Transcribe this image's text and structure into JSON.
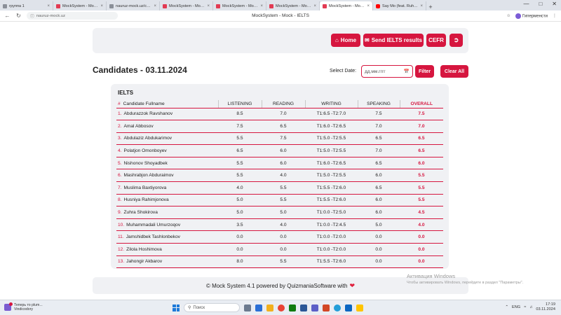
{
  "browser": {
    "tabs": [
      {
        "label": "группа 1",
        "icon": "user-icon",
        "active": false
      },
      {
        "label": "MockSystem - Mock - II",
        "icon": "mocksystem-icon",
        "active": false
      },
      {
        "label": "nauruz-mock.uz/cefr/",
        "icon": "page-icon",
        "active": false
      },
      {
        "label": "MockSystem - Mock - II",
        "icon": "mocksystem-icon",
        "active": false
      },
      {
        "label": "MockSystem - Mock - II",
        "icon": "mocksystem-icon",
        "active": false
      },
      {
        "label": "MockSystem - Mock - II",
        "icon": "mocksystem-icon",
        "active": false
      },
      {
        "label": "MockSystem - Mock - I",
        "icon": "mocksystem-icon",
        "active": true
      },
      {
        "label": "Say Mo (feat. Ruhsora) -",
        "icon": "youtube-icon",
        "active": false
      }
    ],
    "new_tab": "+",
    "url": "nauruz-mock.uz",
    "page_title": "MockSystem - Mock - IELTS",
    "profile_label": "Гиперменсти"
  },
  "header": {
    "home_label": "Home",
    "send_label": "Send IELTS results",
    "cefr_label": "CEFR"
  },
  "filters": {
    "title": "Candidates - 03.11.2024",
    "select_date_label": "Select Date:",
    "date_placeholder": "дд.мм.гггг",
    "filter_label": "Filter",
    "clear_label": "Clear All"
  },
  "table": {
    "heading": "IELTS",
    "columns": {
      "num": "#",
      "name": "Candidate Fullname",
      "listening": "LISTENING",
      "reading": "READING",
      "writing": "WRITING",
      "speaking": "SPEAKING",
      "overall": "OVERALL"
    },
    "rows": [
      {
        "num": "1.",
        "name": "Abdurazzok Ravshanov",
        "listening": "8.5",
        "reading": "7.0",
        "writing": "T1:6.5 -T2:7.0",
        "speaking": "7.5",
        "overall": "7.5"
      },
      {
        "num": "2.",
        "name": "Amal Abbosov",
        "listening": "7.5",
        "reading": "6.5",
        "writing": "T1:6.0 -T2:6.5",
        "speaking": "7.0",
        "overall": "7.0"
      },
      {
        "num": "3.",
        "name": "Abdulaziz Abdukarimov",
        "listening": "5.5",
        "reading": "7.5",
        "writing": "T1:5.0 -T2:5.5",
        "speaking": "6.5",
        "overall": "6.5"
      },
      {
        "num": "4.",
        "name": "Polatjon Omonboyev",
        "listening": "6.5",
        "reading": "6.0",
        "writing": "T1:5.0 -T2:5.5",
        "speaking": "7.0",
        "overall": "6.5"
      },
      {
        "num": "5.",
        "name": "Nishonov Shoyadbek",
        "listening": "5.5",
        "reading": "6.0",
        "writing": "T1:6.0 -T2:6.5",
        "speaking": "6.5",
        "overall": "6.0"
      },
      {
        "num": "6.",
        "name": "Mashrabjon Abduraimov",
        "listening": "5.5",
        "reading": "4.0",
        "writing": "T1:5.0 -T2:5.5",
        "speaking": "6.0",
        "overall": "5.5"
      },
      {
        "num": "7.",
        "name": "Muslima Baxtiyorova",
        "listening": "4.0",
        "reading": "5.5",
        "writing": "T1:5.5 -T2:6.0",
        "speaking": "6.5",
        "overall": "5.5"
      },
      {
        "num": "8.",
        "name": "Husniya Rahimjonova",
        "listening": "5.0",
        "reading": "5.5",
        "writing": "T1:5.5 -T2:6.0",
        "speaking": "6.0",
        "overall": "5.5"
      },
      {
        "num": "9.",
        "name": "Zuhra Shokirova",
        "listening": "5.0",
        "reading": "5.0",
        "writing": "T1:0.0 -T2:5.0",
        "speaking": "6.0",
        "overall": "4.5"
      },
      {
        "num": "10.",
        "name": "Muhammadali Umurzoqov",
        "listening": "3.5",
        "reading": "4.0",
        "writing": "T1:0.0 -T2:4.5",
        "speaking": "5.0",
        "overall": "4.0"
      },
      {
        "num": "11.",
        "name": "Jamshidbek Tashlonbekov",
        "listening": "0.0",
        "reading": "0.0",
        "writing": "T1:0.0 -T2:0.0",
        "speaking": "0.0",
        "overall": "0.0"
      },
      {
        "num": "12.",
        "name": "Zilola Hoshimova",
        "listening": "0.0",
        "reading": "0.0",
        "writing": "T1:0.0 -T2:0.0",
        "speaking": "0.0",
        "overall": "0.0"
      },
      {
        "num": "13.",
        "name": "Jahongir Akbarov",
        "listening": "8.0",
        "reading": "5.5",
        "writing": "T1:5.5 -T2:6.0",
        "speaking": "0.0",
        "overall": "0.0"
      }
    ]
  },
  "footer": {
    "text": "© Mock System 4.1 powered by QuizmaniaSoftware with"
  },
  "watermark": {
    "line1": "Активация Windows",
    "line2": "Чтобы активировать Windows, перейдите в раздел \"Параметры\"."
  },
  "taskbar": {
    "notification_title": "Теперь то plum...",
    "notification_sub": "Vindicodory",
    "search_placeholder": "Поиск",
    "lang": "ENG",
    "time": "17:19",
    "date": "03.11.2024"
  },
  "colors": {
    "accent": "#d6163f",
    "card_bg": "#f0f1f4"
  }
}
